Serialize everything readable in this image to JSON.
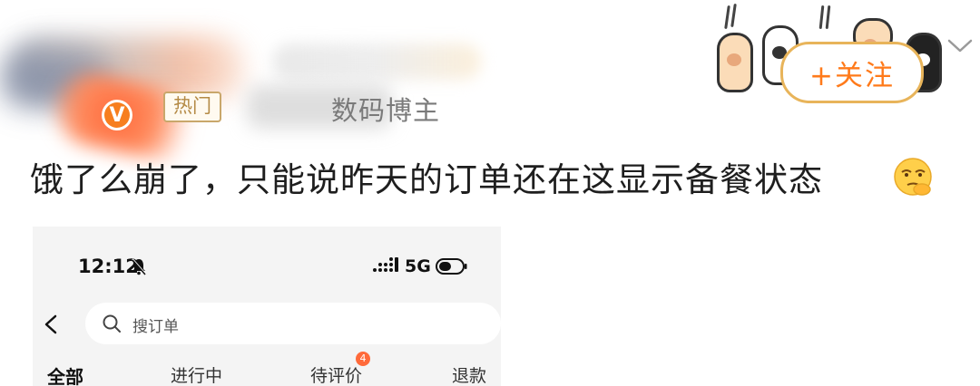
{
  "post": {
    "hot_tag": "热门",
    "meta_suffix": "数码博主",
    "text": "饿了么崩了，只能说昨天的订单还在这显示备餐状态",
    "follow_label": "+关注",
    "icons": {
      "verify": "verified-badge-icon",
      "follow_chevron": "chevron-down-icon",
      "emoji": "thinking-face-emoji-icon"
    },
    "colors": {
      "follow_text": "#ff7a1a",
      "follow_border": "#e8b45a",
      "hot_tag": "#b48a45",
      "verify_badge": "#f77e1e"
    }
  },
  "phone": {
    "status": {
      "time": "12:12",
      "network": "5G"
    },
    "search_placeholder": "搜订单",
    "tabs": [
      {
        "label": "全部",
        "active": true
      },
      {
        "label": "进行中",
        "active": false
      },
      {
        "label": "待评价",
        "active": false,
        "badge": "4"
      },
      {
        "label": "退款",
        "active": false
      }
    ]
  }
}
